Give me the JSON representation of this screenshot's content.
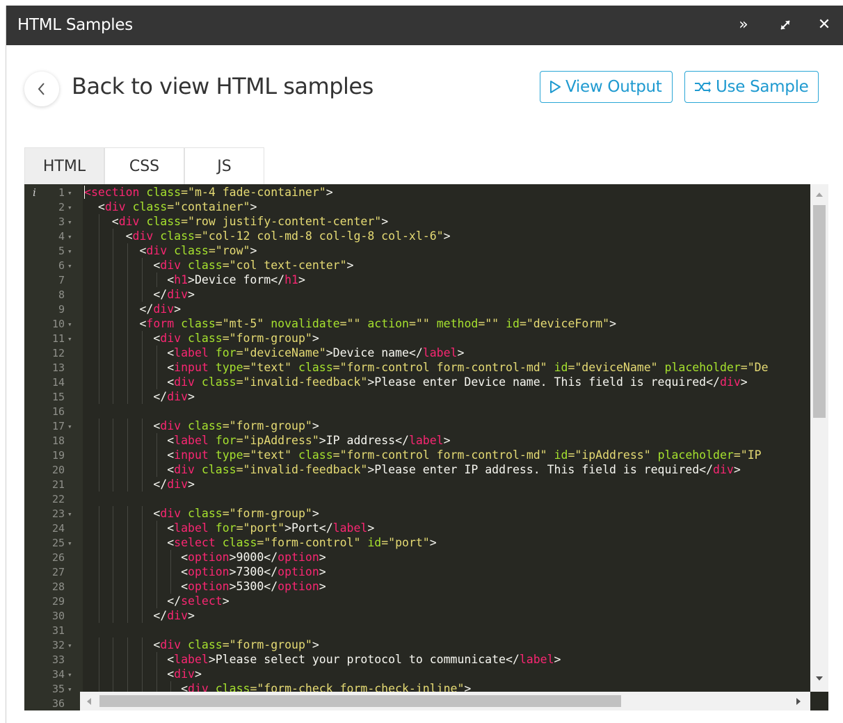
{
  "window": {
    "title": "HTML Samples",
    "controls": {
      "expand_icon": "»",
      "resize_icon": "⤢",
      "close_icon": "✕"
    }
  },
  "header": {
    "back_label": "Back to view HTML samples",
    "view_output_label": "View Output",
    "use_sample_label": "Use Sample"
  },
  "tabs": [
    {
      "label": "HTML",
      "active": true
    },
    {
      "label": "CSS",
      "active": false
    },
    {
      "label": "JS",
      "active": false
    }
  ],
  "editor": {
    "info_glyph": "i",
    "line_numbers": [
      "1",
      "2",
      "3",
      "4",
      "5",
      "6",
      "7",
      "8",
      "9",
      "10",
      "11",
      "12",
      "13",
      "14",
      "15",
      "16",
      "17",
      "18",
      "19",
      "20",
      "21",
      "22",
      "23",
      "24",
      "25",
      "26",
      "27",
      "28",
      "29",
      "30",
      "31",
      "32",
      "33",
      "34",
      "35",
      "36"
    ],
    "foldable_lines": [
      1,
      2,
      3,
      4,
      5,
      6,
      10,
      11,
      17,
      23,
      25,
      32,
      34,
      35
    ],
    "lines": [
      [
        [
          "<",
          "tag"
        ],
        [
          "section ",
          "tag"
        ],
        [
          "class",
          "attr"
        ],
        [
          "=\"m-4 fade-container\"",
          "str"
        ],
        [
          ">",
          "txt"
        ]
      ],
      [
        [
          "  ",
          "txt"
        ],
        [
          "<",
          "txt"
        ],
        [
          "div ",
          "tag"
        ],
        [
          "class",
          "attr"
        ],
        [
          "=\"container\"",
          "str"
        ],
        [
          ">",
          "txt"
        ]
      ],
      [
        [
          "    ",
          "txt"
        ],
        [
          "<",
          "txt"
        ],
        [
          "div ",
          "tag"
        ],
        [
          "class",
          "attr"
        ],
        [
          "=\"row justify-content-center\"",
          "str"
        ],
        [
          ">",
          "txt"
        ]
      ],
      [
        [
          "      ",
          "txt"
        ],
        [
          "<",
          "txt"
        ],
        [
          "div ",
          "tag"
        ],
        [
          "class",
          "attr"
        ],
        [
          "=\"col-12 col-md-8 col-lg-8 col-xl-6\"",
          "str"
        ],
        [
          ">",
          "txt"
        ]
      ],
      [
        [
          "        ",
          "txt"
        ],
        [
          "<",
          "txt"
        ],
        [
          "div ",
          "tag"
        ],
        [
          "class",
          "attr"
        ],
        [
          "=\"row\"",
          "str"
        ],
        [
          ">",
          "txt"
        ]
      ],
      [
        [
          "          ",
          "txt"
        ],
        [
          "<",
          "txt"
        ],
        [
          "div ",
          "tag"
        ],
        [
          "class",
          "attr"
        ],
        [
          "=\"col text-center\"",
          "str"
        ],
        [
          ">",
          "txt"
        ]
      ],
      [
        [
          "            ",
          "txt"
        ],
        [
          "<",
          "txt"
        ],
        [
          "h1",
          "tag"
        ],
        [
          ">Device form</",
          "txt"
        ],
        [
          "h1",
          "tag"
        ],
        [
          ">",
          "txt"
        ]
      ],
      [
        [
          "          ",
          "txt"
        ],
        [
          "</",
          "txt"
        ],
        [
          "div",
          "tag"
        ],
        [
          ">",
          "txt"
        ]
      ],
      [
        [
          "        ",
          "txt"
        ],
        [
          "</",
          "txt"
        ],
        [
          "div",
          "tag"
        ],
        [
          ">",
          "txt"
        ]
      ],
      [
        [
          "        ",
          "txt"
        ],
        [
          "<",
          "txt"
        ],
        [
          "form ",
          "tag"
        ],
        [
          "class",
          "attr"
        ],
        [
          "=\"mt-5\" ",
          "str"
        ],
        [
          "novalidate",
          "attr"
        ],
        [
          "=\"\" ",
          "str"
        ],
        [
          "action",
          "attr"
        ],
        [
          "=\"\" ",
          "str"
        ],
        [
          "method",
          "attr"
        ],
        [
          "=\"\" ",
          "str"
        ],
        [
          "id",
          "attr"
        ],
        [
          "=\"deviceForm\"",
          "str"
        ],
        [
          ">",
          "txt"
        ]
      ],
      [
        [
          "          ",
          "txt"
        ],
        [
          "<",
          "txt"
        ],
        [
          "div ",
          "tag"
        ],
        [
          "class",
          "attr"
        ],
        [
          "=\"form-group\"",
          "str"
        ],
        [
          ">",
          "txt"
        ]
      ],
      [
        [
          "            ",
          "txt"
        ],
        [
          "<",
          "txt"
        ],
        [
          "label ",
          "tag"
        ],
        [
          "for",
          "attr"
        ],
        [
          "=\"deviceName\"",
          "str"
        ],
        [
          ">Device name</",
          "txt"
        ],
        [
          "label",
          "tag"
        ],
        [
          ">",
          "txt"
        ]
      ],
      [
        [
          "            ",
          "txt"
        ],
        [
          "<",
          "txt"
        ],
        [
          "input ",
          "tag"
        ],
        [
          "type",
          "attr"
        ],
        [
          "=\"text\" ",
          "str"
        ],
        [
          "class",
          "attr"
        ],
        [
          "=\"form-control form-control-md\" ",
          "str"
        ],
        [
          "id",
          "attr"
        ],
        [
          "=\"deviceName\" ",
          "str"
        ],
        [
          "placeholder",
          "attr"
        ],
        [
          "=\"De",
          "str"
        ]
      ],
      [
        [
          "            ",
          "txt"
        ],
        [
          "<",
          "txt"
        ],
        [
          "div ",
          "tag"
        ],
        [
          "class",
          "attr"
        ],
        [
          "=\"invalid-feedback\"",
          "str"
        ],
        [
          ">Please enter Device name. This field is required</",
          "txt"
        ],
        [
          "div",
          "tag"
        ],
        [
          ">",
          "txt"
        ]
      ],
      [
        [
          "          ",
          "txt"
        ],
        [
          "</",
          "txt"
        ],
        [
          "div",
          "tag"
        ],
        [
          ">",
          "txt"
        ]
      ],
      [
        [
          "",
          "txt"
        ]
      ],
      [
        [
          "          ",
          "txt"
        ],
        [
          "<",
          "txt"
        ],
        [
          "div ",
          "tag"
        ],
        [
          "class",
          "attr"
        ],
        [
          "=\"form-group\"",
          "str"
        ],
        [
          ">",
          "txt"
        ]
      ],
      [
        [
          "            ",
          "txt"
        ],
        [
          "<",
          "txt"
        ],
        [
          "label ",
          "tag"
        ],
        [
          "for",
          "attr"
        ],
        [
          "=\"ipAddress\"",
          "str"
        ],
        [
          ">IP address</",
          "txt"
        ],
        [
          "label",
          "tag"
        ],
        [
          ">",
          "txt"
        ]
      ],
      [
        [
          "            ",
          "txt"
        ],
        [
          "<",
          "txt"
        ],
        [
          "input ",
          "tag"
        ],
        [
          "type",
          "attr"
        ],
        [
          "=\"text\" ",
          "str"
        ],
        [
          "class",
          "attr"
        ],
        [
          "=\"form-control form-control-md\" ",
          "str"
        ],
        [
          "id",
          "attr"
        ],
        [
          "=\"ipAddress\" ",
          "str"
        ],
        [
          "placeholder",
          "attr"
        ],
        [
          "=\"IP",
          "str"
        ]
      ],
      [
        [
          "            ",
          "txt"
        ],
        [
          "<",
          "txt"
        ],
        [
          "div ",
          "tag"
        ],
        [
          "class",
          "attr"
        ],
        [
          "=\"invalid-feedback\"",
          "str"
        ],
        [
          ">Please enter IP address. This field is required</",
          "txt"
        ],
        [
          "div",
          "tag"
        ],
        [
          ">",
          "txt"
        ]
      ],
      [
        [
          "          ",
          "txt"
        ],
        [
          "</",
          "txt"
        ],
        [
          "div",
          "tag"
        ],
        [
          ">",
          "txt"
        ]
      ],
      [
        [
          "",
          "txt"
        ]
      ],
      [
        [
          "          ",
          "txt"
        ],
        [
          "<",
          "txt"
        ],
        [
          "div ",
          "tag"
        ],
        [
          "class",
          "attr"
        ],
        [
          "=\"form-group\"",
          "str"
        ],
        [
          ">",
          "txt"
        ]
      ],
      [
        [
          "            ",
          "txt"
        ],
        [
          "<",
          "txt"
        ],
        [
          "label ",
          "tag"
        ],
        [
          "for",
          "attr"
        ],
        [
          "=\"port\"",
          "str"
        ],
        [
          ">Port</",
          "txt"
        ],
        [
          "label",
          "tag"
        ],
        [
          ">",
          "txt"
        ]
      ],
      [
        [
          "            ",
          "txt"
        ],
        [
          "<",
          "txt"
        ],
        [
          "select ",
          "tag"
        ],
        [
          "class",
          "attr"
        ],
        [
          "=\"form-control\" ",
          "str"
        ],
        [
          "id",
          "attr"
        ],
        [
          "=\"port\"",
          "str"
        ],
        [
          ">",
          "txt"
        ]
      ],
      [
        [
          "              ",
          "txt"
        ],
        [
          "<",
          "txt"
        ],
        [
          "option",
          "tag"
        ],
        [
          ">9000</",
          "txt"
        ],
        [
          "option",
          "tag"
        ],
        [
          ">",
          "txt"
        ]
      ],
      [
        [
          "              ",
          "txt"
        ],
        [
          "<",
          "txt"
        ],
        [
          "option",
          "tag"
        ],
        [
          ">7300</",
          "txt"
        ],
        [
          "option",
          "tag"
        ],
        [
          ">",
          "txt"
        ]
      ],
      [
        [
          "              ",
          "txt"
        ],
        [
          "<",
          "txt"
        ],
        [
          "option",
          "tag"
        ],
        [
          ">5300</",
          "txt"
        ],
        [
          "option",
          "tag"
        ],
        [
          ">",
          "txt"
        ]
      ],
      [
        [
          "            ",
          "txt"
        ],
        [
          "</",
          "txt"
        ],
        [
          "select",
          "tag"
        ],
        [
          ">",
          "txt"
        ]
      ],
      [
        [
          "          ",
          "txt"
        ],
        [
          "</",
          "txt"
        ],
        [
          "div",
          "tag"
        ],
        [
          ">",
          "txt"
        ]
      ],
      [
        [
          "",
          "txt"
        ]
      ],
      [
        [
          "          ",
          "txt"
        ],
        [
          "<",
          "txt"
        ],
        [
          "div ",
          "tag"
        ],
        [
          "class",
          "attr"
        ],
        [
          "=\"form-group\"",
          "str"
        ],
        [
          ">",
          "txt"
        ]
      ],
      [
        [
          "            ",
          "txt"
        ],
        [
          "<",
          "txt"
        ],
        [
          "label",
          "tag"
        ],
        [
          ">Please select your protocol to communicate</",
          "txt"
        ],
        [
          "label",
          "tag"
        ],
        [
          ">",
          "txt"
        ]
      ],
      [
        [
          "            ",
          "txt"
        ],
        [
          "<",
          "txt"
        ],
        [
          "div",
          "tag"
        ],
        [
          ">",
          "txt"
        ]
      ],
      [
        [
          "              ",
          "txt"
        ],
        [
          "<",
          "txt"
        ],
        [
          "div ",
          "tag"
        ],
        [
          "class",
          "attr"
        ],
        [
          "=\"form-check form-check-inline\"",
          "str"
        ],
        [
          ">",
          "txt"
        ]
      ],
      [
        [
          "",
          "txt"
        ]
      ]
    ]
  },
  "colors": {
    "titlebar": "#353535",
    "accent": "#2aa6d6",
    "editor_bg": "#272822",
    "tag": "#f92672",
    "attr": "#a6e22e",
    "string": "#e6db74"
  }
}
